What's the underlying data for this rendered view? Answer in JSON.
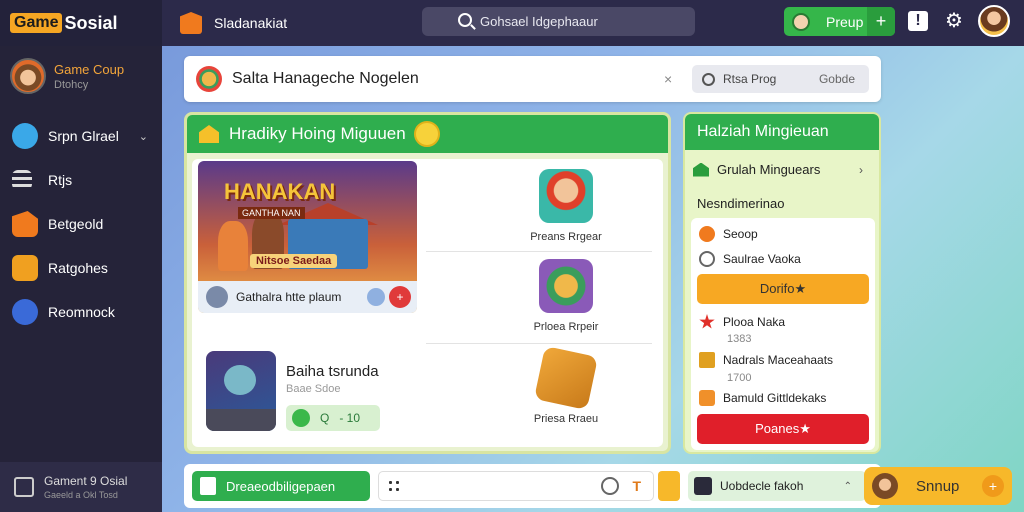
{
  "brand": {
    "badge": "Game",
    "name": "Sosial"
  },
  "header": {
    "title": "Sladanakiat",
    "search_text": "Gohsael Idgephaaur",
    "preup_label": "Preup",
    "plus_label": "+",
    "info_label": "!",
    "gear_label": "⚙"
  },
  "profile": {
    "name": "Game Coup",
    "sub": "Dtohcy"
  },
  "sidebar": {
    "items": [
      {
        "label": "Srpn Glrael",
        "chevron": "⌄"
      },
      {
        "label": "Rtjs"
      },
      {
        "label": "Betgeold"
      },
      {
        "label": "Ratgohes"
      },
      {
        "label": "Reomnock"
      }
    ],
    "footer_title": "Gament 9 Osial",
    "footer_sub": "Gaeeld a Okl Tosd"
  },
  "search_card": {
    "title": "Salta Hanageche Nogelen",
    "close": "×",
    "box_left": "Rtsa Prog",
    "box_right": "Gobde"
  },
  "main": {
    "title": "Hradiky Hoing Miguuen",
    "feature": {
      "title": "HANAKAN",
      "subtitle": "GANTHA NAN",
      "banner": "Nitsoe Saedaa",
      "bar_text": "Gathalra htte plaum",
      "close_label": "+"
    },
    "rewards": [
      {
        "label": "Preans Rrgear"
      },
      {
        "label": "Prloea Rrpeir"
      },
      {
        "label": "Priesa Rraeu"
      }
    ],
    "game2": {
      "title": "Baiha tsrunda",
      "sub": "Baae Sdoe",
      "chip_q": "Q",
      "chip_n": "- 10"
    }
  },
  "right": {
    "title": "Halziah Mingieuan",
    "row_label": "Grulah Minguears",
    "row_arrow": "›",
    "sub": "Nesndimerinao",
    "items": [
      {
        "label": "Seoop"
      },
      {
        "label": "Saulrae Vaoka"
      }
    ],
    "btn1": "Dorifo★",
    "list": [
      {
        "label": "Plooa Naka",
        "num": "1383"
      },
      {
        "label": "Nadrals Maceahaats",
        "num": "1700"
      },
      {
        "label": "Bamuld Gittldekaks",
        "num": ""
      }
    ],
    "btn2": "Poanes★"
  },
  "bottom": {
    "green_label": "Dreaeodbiligepaen",
    "t_icon": "T",
    "search_label": "Uobdecle fakoh",
    "search_arrow": "⌃",
    "signup_label": "Snnup",
    "signup_plus": "+"
  }
}
